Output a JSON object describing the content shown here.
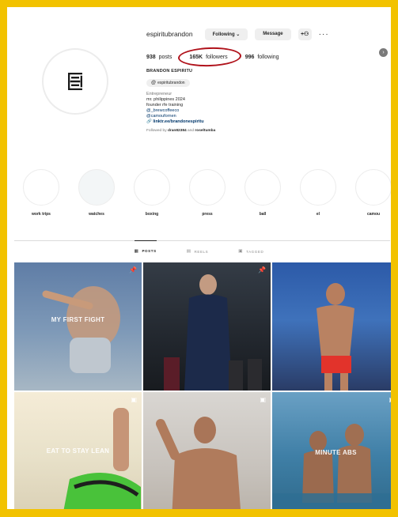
{
  "profile": {
    "username": "espiritubrandon",
    "following_button": "Following ⌄",
    "message_button": "Message",
    "add_user_icon": "+⚇",
    "more_icon": "···",
    "stats": {
      "posts_count": "938",
      "posts_label": "posts",
      "followers_count": "165K",
      "followers_label": "followers",
      "following_count": "996",
      "following_label": "following"
    },
    "full_name": "BRANDON ESPIRITU",
    "threads_handle": "espiritubrandon",
    "bio": {
      "category": "Entrepreneur",
      "line1": "mr. philippines 2024",
      "line2": "founder rfe training",
      "mention1": "@_brewcoffeeco",
      "mention2": "@camoufornen",
      "link": "linktr.ee/brandonespiritu"
    },
    "followed_by": {
      "prefix": "Followed by",
      "user1": "dran82384",
      "and": "and",
      "user2": "roseltumba"
    }
  },
  "highlights": [
    {
      "label": "work trips"
    },
    {
      "label": "watches"
    },
    {
      "label": "boxing"
    },
    {
      "label": "press"
    },
    {
      "label": "ball"
    },
    {
      "label": "el"
    },
    {
      "label": "camou"
    }
  ],
  "tabs": [
    {
      "label": "POSTS",
      "icon": "grid-icon"
    },
    {
      "label": "REELS",
      "icon": "reels-icon"
    },
    {
      "label": "TAGGED",
      "icon": "tagged-icon"
    }
  ],
  "posts": [
    {
      "overlay_text": "MY FIRST FIGHT"
    },
    {
      "overlay_text": ""
    },
    {
      "overlay_text": ""
    },
    {
      "overlay_text": "EAT TO STAY LEAN"
    },
    {
      "overlay_text": ""
    },
    {
      "overlay_text": "MINUTE ABS"
    }
  ],
  "colors": {
    "frame": "#f2c200",
    "circle_annotation": "#b0121b",
    "link": "#00376b"
  }
}
